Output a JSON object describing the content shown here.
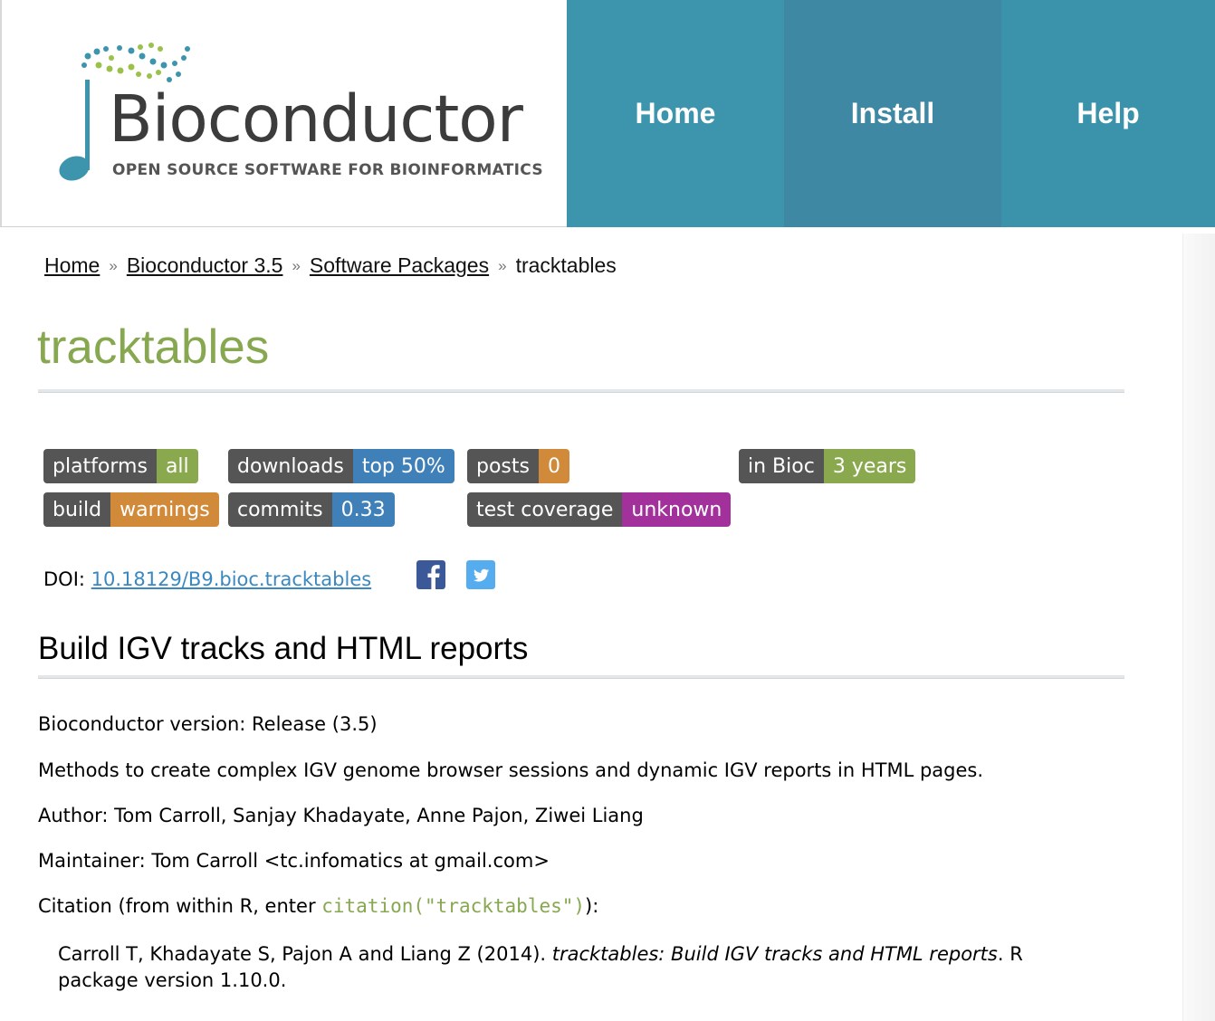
{
  "logo": {
    "wordmark": "Bioconductor",
    "tagline": "OPEN SOURCE SOFTWARE FOR BIOINFORMATICS"
  },
  "nav": {
    "home": "Home",
    "install": "Install",
    "help": "Help"
  },
  "colors": {
    "nav_bg": "#3d94ad",
    "title_green": "#87a850",
    "link_blue": "#3a88c0"
  },
  "breadcrumb": {
    "home": "Home",
    "release": "Bioconductor 3.5",
    "section": "Software Packages",
    "current": "tracktables",
    "separator": "»"
  },
  "package": {
    "name": "tracktables"
  },
  "badges": {
    "platforms": {
      "label": "platforms",
      "value": "all",
      "color": "#8aa94f"
    },
    "downloads": {
      "label": "downloads",
      "value": "top 50%",
      "color": "#3f80b9"
    },
    "posts": {
      "label": "posts",
      "value": "0",
      "color": "#d18a3a"
    },
    "in_bioc": {
      "label": "in Bioc",
      "value": "3 years",
      "color": "#8aa94f"
    },
    "build": {
      "label": "build",
      "value": "warnings",
      "color": "#d18a3a"
    },
    "commits": {
      "label": "commits",
      "value": "0.33",
      "color": "#3f80b9"
    },
    "coverage": {
      "label": "test coverage",
      "value": "unknown",
      "color": "#a3319b"
    }
  },
  "doi": {
    "label": "DOI:",
    "value": "10.18129/B9.bioc.tracktables"
  },
  "social": {
    "facebook": "facebook-icon",
    "twitter": "twitter-icon"
  },
  "subtitle": "Build IGV tracks and HTML reports",
  "details": {
    "version": "Bioconductor version: Release (3.5)",
    "description": "Methods to create complex IGV genome browser sessions and dynamic IGV reports in HTML pages.",
    "author": "Author: Tom Carroll, Sanjay Khadayate, Anne Pajon, Ziwei Liang",
    "maintainer": "Maintainer: Tom Carroll <tc.infomatics at gmail.com>",
    "citation_prefix": "Citation (from within R, enter ",
    "citation_code": "citation(\"tracktables\")",
    "citation_suffix": "):"
  },
  "citation": {
    "authors": "Carroll T, Khadayate S, Pajon A and Liang Z (2014). ",
    "title": "tracktables: Build IGV tracks and HTML reports",
    "rest": ". R package version 1.10.0."
  }
}
